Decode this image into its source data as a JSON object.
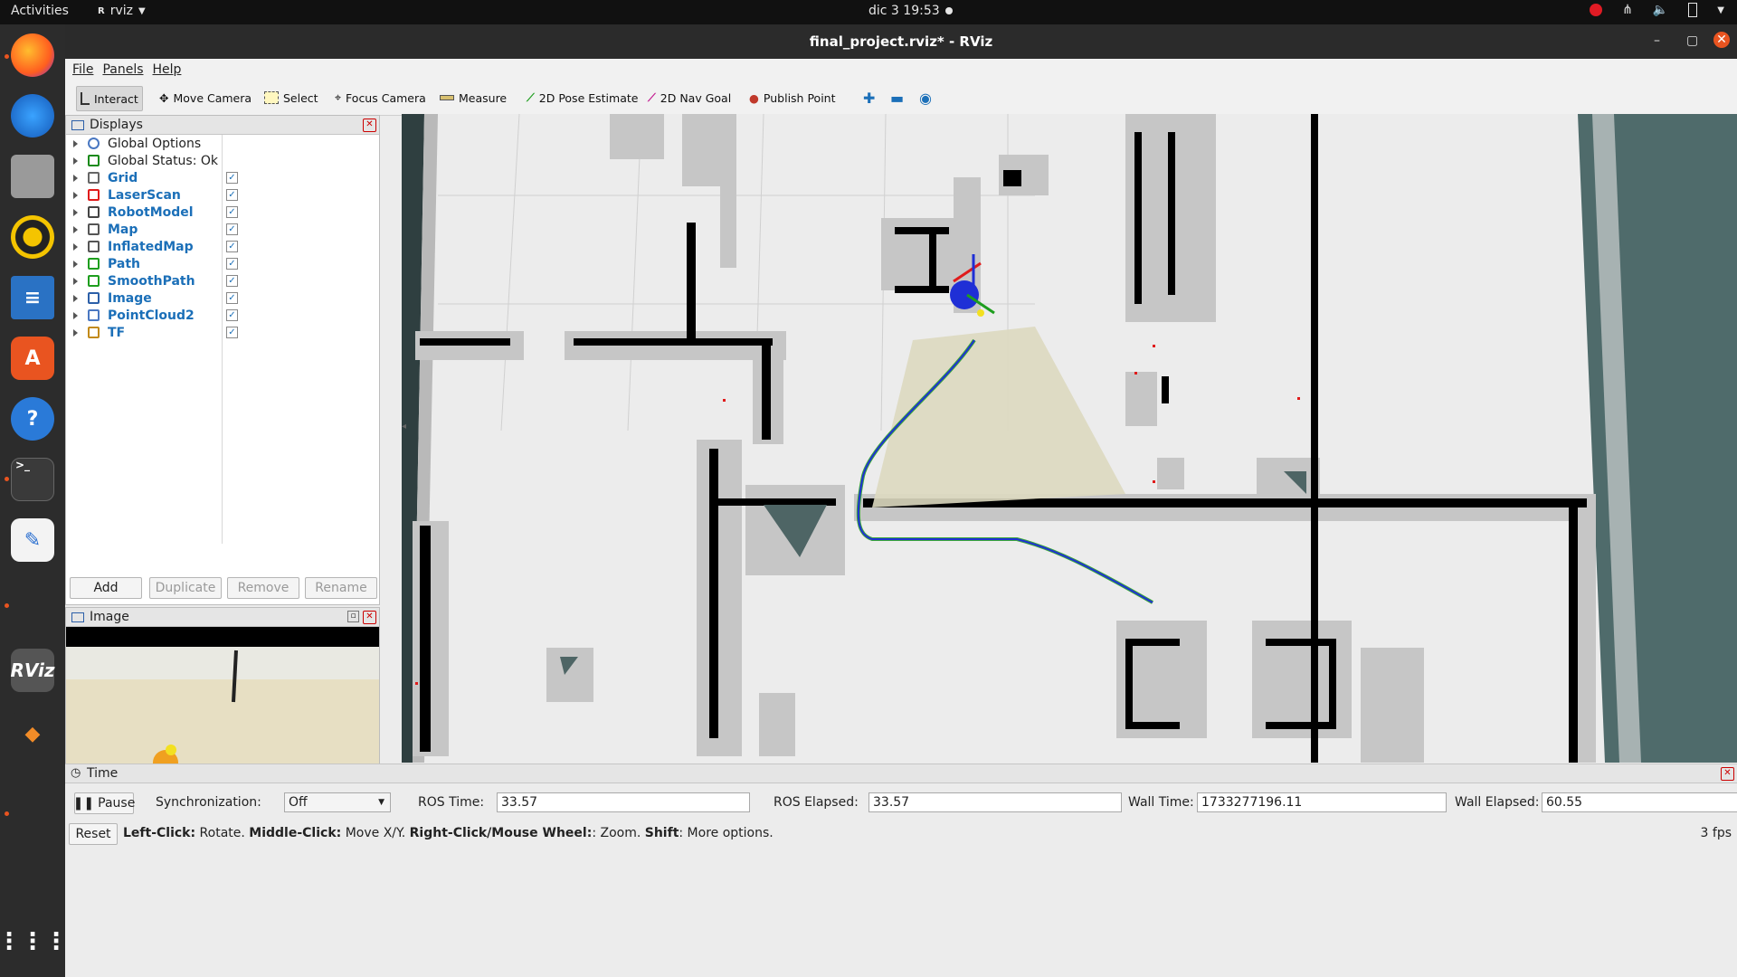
{
  "topbar": {
    "activities": "Activities",
    "app": "rviz",
    "clock": "dic 3  19:53"
  },
  "window": {
    "title": "final_project.rviz* - RViz"
  },
  "menu": [
    "File",
    "Panels",
    "Help"
  ],
  "toolbar": {
    "interact": "Interact",
    "move_camera": "Move Camera",
    "select": "Select",
    "focus_camera": "Focus Camera",
    "measure": "Measure",
    "pose_estimate": "2D Pose Estimate",
    "nav_goal": "2D Nav Goal",
    "publish_point": "Publish Point"
  },
  "displays": {
    "title": "Displays",
    "items": [
      {
        "label": "Global Options",
        "checked": null,
        "style": "plain",
        "icon": "gear-icon"
      },
      {
        "label": "Global Status: Ok",
        "checked": null,
        "style": "plain",
        "icon": "check-icon"
      },
      {
        "label": "Grid",
        "checked": true,
        "style": "blue",
        "icon": "grid-icon"
      },
      {
        "label": "LaserScan",
        "checked": true,
        "style": "blue",
        "icon": "laser-icon"
      },
      {
        "label": "RobotModel",
        "checked": true,
        "style": "blue",
        "icon": "robot-icon"
      },
      {
        "label": "Map",
        "checked": true,
        "style": "blue",
        "icon": "map-icon"
      },
      {
        "label": "InflatedMap",
        "checked": true,
        "style": "blue",
        "icon": "map-icon"
      },
      {
        "label": "Path",
        "checked": true,
        "style": "blue",
        "icon": "path-icon"
      },
      {
        "label": "SmoothPath",
        "checked": true,
        "style": "blue",
        "icon": "path-icon"
      },
      {
        "label": "Image",
        "checked": true,
        "style": "blue",
        "icon": "image-icon"
      },
      {
        "label": "PointCloud2",
        "checked": true,
        "style": "blue",
        "icon": "pointcloud-icon"
      },
      {
        "label": "TF",
        "checked": true,
        "style": "blue",
        "icon": "tf-icon"
      }
    ],
    "buttons": {
      "add": "Add",
      "duplicate": "Duplicate",
      "remove": "Remove",
      "rename": "Rename"
    }
  },
  "image_panel": {
    "title": "Image"
  },
  "time": {
    "title": "Time",
    "pause": "Pause",
    "sync_label": "Synchronization:",
    "sync_value": "Off",
    "ros_time_label": "ROS Time:",
    "ros_time": "33.57",
    "ros_elapsed_label": "ROS Elapsed:",
    "ros_elapsed": "33.57",
    "wall_time_label": "Wall Time:",
    "wall_time": "1733277196.11",
    "wall_elapsed_label": "Wall Elapsed:",
    "wall_elapsed": "60.55"
  },
  "status": {
    "reset": "Reset",
    "left_click": "Left-Click:",
    "left_click_desc": " Rotate. ",
    "middle_click": "Middle-Click:",
    "middle_click_desc": " Move X/Y. ",
    "right_click": "Right-Click/Mouse Wheel:",
    "right_click_desc": ": Zoom. ",
    "shift": "Shift",
    "shift_desc": ": More options.",
    "fps": "3 fps"
  },
  "colors": {
    "accent": "#1b6fb8",
    "ubuntu_orange": "#e95420",
    "path_blue": "#1f2fd6",
    "path_green": "#3aa63a",
    "laser_red": "#e01b1b"
  }
}
